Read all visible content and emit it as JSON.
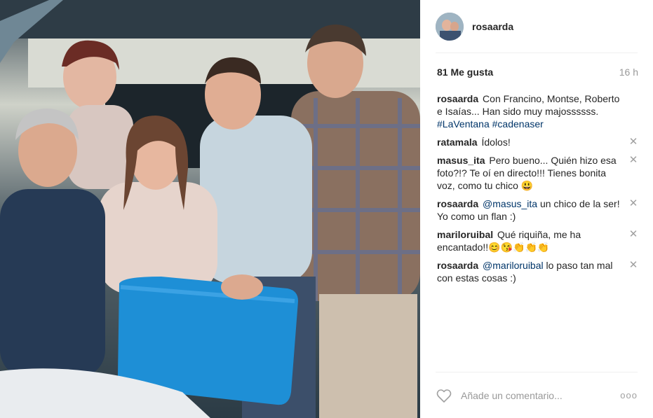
{
  "post": {
    "username": "rosaarda",
    "likes": "81 Me gusta",
    "time": "16 h"
  },
  "caption": {
    "author": "rosaarda",
    "text": "Con Francino, Montse, Roberto e Isaías... Han sido muy majossssss.",
    "hashtags": "#LaVentana #cadenaser"
  },
  "comments": [
    {
      "author": "ratamala",
      "parts": [
        {
          "text": "Ídolos!"
        }
      ]
    },
    {
      "author": "masus_ita",
      "parts": [
        {
          "text": "Pero bueno... Quién hizo esa foto?!? Te oí en directo!!! Tienes bonita voz, como tu chico 😃"
        }
      ]
    },
    {
      "author": "rosaarda",
      "mention": "@masus_ita",
      "parts": [
        {
          "text": " un chico de la ser! Yo como un flan :)"
        }
      ]
    },
    {
      "author": "mariloruibal",
      "parts": [
        {
          "text": "Qué riquiña, me ha encantado!!😊😘👏👏👏"
        }
      ]
    },
    {
      "author": "rosaarda",
      "mention": "@mariloruibal",
      "parts": [
        {
          "text": " lo paso tan mal con estas cosas :)"
        }
      ]
    }
  ],
  "footer": {
    "placeholder": "Añade un comentario...",
    "more_label": "ooo"
  },
  "icons": {
    "heart": "heart-icon",
    "delete": "close-icon",
    "more": "more-options-icon"
  },
  "colors": {
    "link": "#003569",
    "muted": "#999999",
    "chair": "#1e8fd6"
  }
}
